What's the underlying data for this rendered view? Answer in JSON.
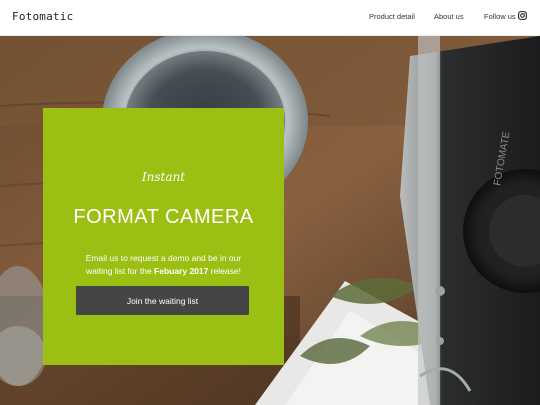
{
  "nav": {
    "brand": "Fotomatic",
    "links": [
      "Product detail",
      "About us",
      "Follow us"
    ]
  },
  "hero": {
    "kicker": "Instant",
    "title": "FORMAT CAMERA",
    "description_pre": "Email us to request a demo and be in our waiting list for the ",
    "description_bold": "Febuary 2017",
    "description_post": " release!",
    "cta": "Join the waiting list",
    "camera_lens_text": "FOTOMATE"
  },
  "colors": {
    "card": "#9cbf14",
    "button": "#454545"
  },
  "icons": {
    "social": "instagram-icon"
  }
}
